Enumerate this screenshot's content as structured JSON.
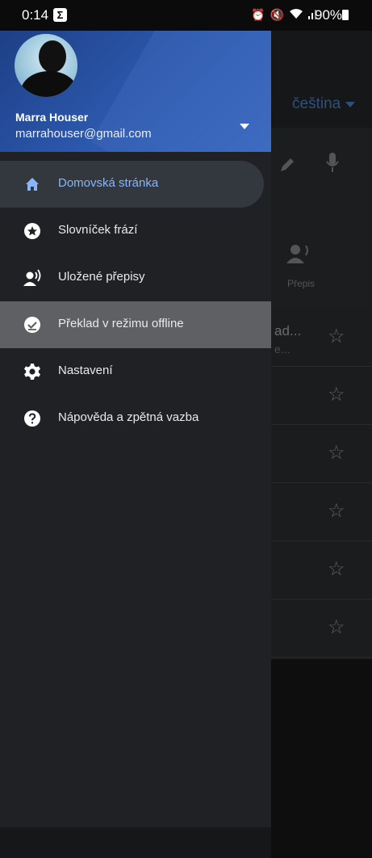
{
  "status_bar": {
    "time": "0:14",
    "battery": "90%",
    "sigma": "Σ"
  },
  "background_app": {
    "language": "čeština",
    "conversation_label": "Přepis",
    "rows": [
      {
        "text": "ad...",
        "sub": "e..."
      },
      {
        "text": "",
        "sub": ""
      },
      {
        "text": "",
        "sub": ""
      },
      {
        "text": "",
        "sub": ""
      },
      {
        "text": "",
        "sub": ""
      },
      {
        "text": "",
        "sub": ""
      }
    ]
  },
  "account": {
    "name": "Marra Houser",
    "email": "marrahouser@gmail.com"
  },
  "menu": {
    "items": [
      {
        "label": "Domovská stránka",
        "icon": "home-icon"
      },
      {
        "label": "Slovníček frází",
        "icon": "star-circle-icon"
      },
      {
        "label": "Uložené přepisy",
        "icon": "person-speaking-icon"
      },
      {
        "label": "Překlad v režimu offline",
        "icon": "offline-check-icon"
      },
      {
        "label": "Nastavení",
        "icon": "gear-icon"
      },
      {
        "label": "Nápověda a zpětná vazba",
        "icon": "help-icon"
      }
    ]
  },
  "colors": {
    "accent": "#8ab4f8",
    "header": "#2d5ab0",
    "drawer": "#202124"
  }
}
